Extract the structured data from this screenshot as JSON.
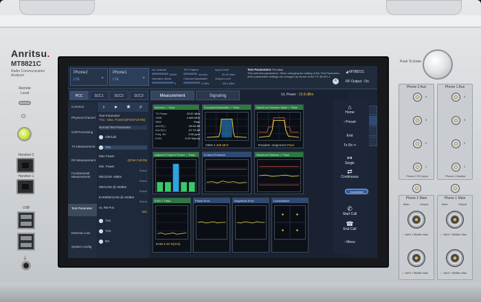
{
  "device": {
    "brand": "Anritsu",
    "model": "MT8821C",
    "description": "Radio Communication Analyzer",
    "remote_label": "Remote",
    "local_label": "Local",
    "handset2_label": "Handset 2",
    "handset1_label": "Handset 1",
    "usb_label": "USB",
    "push_to_enter": "Push To Enter"
  },
  "topbar": {
    "tab_phone2": {
      "title": "Phone2",
      "sub": "LTE"
    },
    "tab_phone1": {
      "title": "Phone1",
      "sub": "LTE"
    },
    "params": {
      "ul_channel": {
        "label": "UL Channel",
        "value": "18300"
      },
      "tpc_pattern": {
        "label": "TPC Pattern",
        "value": "All Auto"
      },
      "input_level": {
        "label": "Input Level",
        "value": "20.00 dBm"
      },
      "operation_band": {
        "label": "Operation Band",
        "value": "3"
      },
      "channel_bandwidth": {
        "label": "Channel Bandwidth",
        "value": "5 MHz"
      },
      "output_level": {
        "label": "Output Level",
        "value": "-85.0 dBm"
      }
    },
    "test_params": {
      "title": "Test Parameters",
      "tag": "TX1 Max",
      "body": "This sets test parameters. When changing the setting of the Test Parameter, other parameters settings are changed as shown in the TS 36.521-1"
    },
    "close_label": "×",
    "right_model": "MT8821C",
    "rf_output": "RF Output : On"
  },
  "subtabs": [
    "PCC",
    "SCC1",
    "SCC2",
    "SCC3"
  ],
  "left_nav": [
    {
      "label": "Common",
      "selected": false
    },
    {
      "label": "Physical Channel",
      "selected": false
    },
    {
      "label": "Call Processing",
      "selected": false
    },
    {
      "label": "TX Measurement",
      "selected": false
    },
    {
      "label": "RX Measurement",
      "selected": false
    },
    {
      "label": "Fundamental Measurement",
      "selected": false
    },
    {
      "label": "Test Parameter",
      "selected": true
    },
    {
      "label": "External Loss",
      "selected": false
    },
    {
      "label": "System Config",
      "selected": false
    }
  ],
  "tree": {
    "test_parameter_label": "Test Parameter",
    "test_parameter_value": "TX1 - Max. Power(QPSK/Full RB)",
    "normal_label": "Normal Test Parameter",
    "idle_call": "Idle/Call",
    "tx1": "TX1",
    "max_power": "Max Power",
    "qpsk_full_rb": "QPSK Full RB",
    "min_power": "Min. Power",
    "select": "Select",
    "rb1": "RB/12/48 -5dBm",
    "rb2": "RB/12/48 @-30dBm",
    "rb3": "EVM/RB/12/48 @-40dBm",
    "ul_rb_pos": "UL RB Pos",
    "ul_rb_val": "Min",
    "tx2": "TX2",
    "tx3": "TX3",
    "rx": "RX"
  },
  "measurement": {
    "tab_measurement": "Measurement",
    "tab_signaling": "Signaling",
    "ul_power_label": "UL Power :",
    "ul_power_value": "22.8 dBm",
    "numeric": {
      "title": "Numeric",
      "status": "Pass",
      "rows": [
        {
          "label": "TX Power",
          "value": "22.87 dBm"
        },
        {
          "label": "OBW",
          "value": "4.465 MHz"
        },
        {
          "label": "SEM",
          "value": "Pass"
        },
        {
          "label": "ACLR(-)",
          "value": "-39.06 dB"
        },
        {
          "label": "ACLR(+)",
          "value": "-37.70 dB"
        },
        {
          "label": "Freq. Err",
          "value": "0.00 ppm"
        },
        {
          "label": "EVM",
          "value": "3.23 %(rms)"
        }
      ]
    },
    "obw": {
      "title": "Occupied Bandwidth",
      "status": "Pass",
      "footer_label": "OBW",
      "footer_value": "4.465 MHz"
    },
    "sem": {
      "title": "Spectrum Emission Mask",
      "status": "Pass",
      "footer_label": "Template Judgement",
      "footer_value": "Pass"
    },
    "aclr": {
      "title": "Adjacent Channel Power",
      "status": "Pass",
      "bars": [
        0.34,
        0.34,
        1.0,
        0.34,
        0.34
      ]
    },
    "inband": {
      "title": "In Band Emission"
    },
    "flatness": {
      "title": "Spectrum Flatness",
      "status": "Pass"
    },
    "evm": {
      "title": "EVM",
      "status": "Pass",
      "footer_label": "EVM",
      "footer_value": "3.23 %(rms)"
    },
    "phase_error": {
      "title": "Phase Error"
    },
    "magnitude_error": {
      "title": "Magnitude Error"
    },
    "constellation": {
      "title": "Constellation"
    }
  },
  "side_list": [
    {
      "label": "Main Screen",
      "selected": false
    },
    {
      "label": "Fundamental",
      "selected": true
    },
    {
      "label": "Sub Screen",
      "selected": false
    },
    {
      "label": "Top",
      "selected": false
    }
  ],
  "right_bar": {
    "home": "Home",
    "preset": "Preset",
    "end": "End",
    "tx_rx": "Tx Rx",
    "single": "Single",
    "continuous": "Continuous",
    "connected": "Connected",
    "start_call": "Start Call",
    "end_call": "End Call",
    "menu": "Menu"
  },
  "ports": {
    "phone2_aux": "Phone 2 Aux",
    "phone1_aux": "Phone 1 Aux",
    "phone1_rx_input": "Phone 1 RX Input",
    "phone1_monitor": "Phone 1 Monitor",
    "phone2_main": "Phone 2 Main",
    "phone1_main": "Phone 1 Main",
    "port_numbers": [
      "4",
      "3",
      "2",
      "1"
    ],
    "main_port_labels": [
      "Main",
      "Output"
    ],
    "warn_text": "MAX +35dBm Max"
  }
}
